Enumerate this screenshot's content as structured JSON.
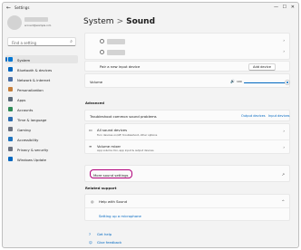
{
  "window": {
    "title": "Settings",
    "back_glyph": "←",
    "minimize_glyph": "—",
    "maximize_glyph": "☐",
    "close_glyph": "✕"
  },
  "user": {
    "email": "account@example.com"
  },
  "search": {
    "placeholder": "Find a setting",
    "icon": "search-icon"
  },
  "nav": [
    {
      "label": "System",
      "icon": "monitor-icon",
      "color": "#0078d4",
      "active": true
    },
    {
      "label": "Bluetooth & devices",
      "icon": "bluetooth-icon",
      "color": "#0067c0"
    },
    {
      "label": "Network & internet",
      "icon": "wifi-icon",
      "color": "#4a6fa5"
    },
    {
      "label": "Personalization",
      "icon": "brush-icon",
      "color": "#c57e3a"
    },
    {
      "label": "Apps",
      "icon": "apps-icon",
      "color": "#5c6b7a"
    },
    {
      "label": "Accounts",
      "icon": "person-icon",
      "color": "#2e8b57"
    },
    {
      "label": "Time & language",
      "icon": "clock-icon",
      "color": "#2b6cb0"
    },
    {
      "label": "Gaming",
      "icon": "gamepad-icon",
      "color": "#6b7280"
    },
    {
      "label": "Accessibility",
      "icon": "accessibility-icon",
      "color": "#1e73be"
    },
    {
      "label": "Privacy & security",
      "icon": "shield-icon",
      "color": "#6b7280"
    },
    {
      "label": "Windows Update",
      "icon": "update-icon",
      "color": "#0067c0"
    }
  ],
  "breadcrumb": {
    "parent": "System",
    "separator": ">",
    "current": "Sound"
  },
  "pair_device": {
    "label": "Pair a new input device",
    "button": "Add device"
  },
  "volume": {
    "label": "Volume",
    "value": "100",
    "level": 1.0,
    "speaker_glyph": "🔊"
  },
  "advanced": {
    "heading": "Advanced",
    "troubleshoot_label": "Troubleshoot common sound problems",
    "output_link": "Output devices",
    "input_link": "Input devices",
    "all_devices_title": "All sound devices",
    "all_devices_sub": "Turn devices on/off, troubleshoot, other options",
    "mixer_title": "Volume mixer",
    "mixer_sub": "App volume mix, app input & output devices",
    "more_settings": "More sound settings",
    "external_glyph": "↗"
  },
  "related": {
    "heading": "Related support",
    "help_label": "Help with Sound",
    "setup_link": "Setting up a microphone",
    "collapse_glyph": "^"
  },
  "footer": {
    "get_help": "Get help",
    "feedback": "Give feedback"
  }
}
